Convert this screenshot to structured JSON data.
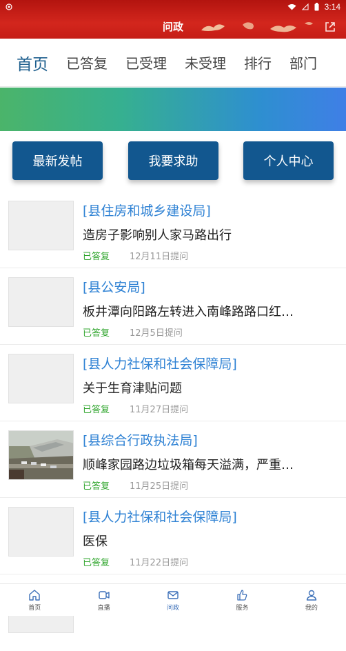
{
  "status_bar": {
    "time": "3:14"
  },
  "header": {
    "title": "问政"
  },
  "tabs": [
    {
      "label": "首页",
      "active": true
    },
    {
      "label": "已答复"
    },
    {
      "label": "已受理"
    },
    {
      "label": "未受理"
    },
    {
      "label": "排行"
    },
    {
      "label": "部门"
    }
  ],
  "quick_buttons": [
    {
      "label": "最新发帖"
    },
    {
      "label": "我要求助"
    },
    {
      "label": "个人中心"
    }
  ],
  "posts": [
    {
      "dept": "[县住房和城乡建设局]",
      "title": "造房子影响别人家马路出行",
      "status": "已答复",
      "date": "12月11日提问"
    },
    {
      "dept": "[县公安局]",
      "title": "板井潭向阳路左转进入南峰路路口红…",
      "status": "已答复",
      "date": "12月5日提问"
    },
    {
      "dept": "[县人力社保和社会保障局]",
      "title": "关于生育津贴问题",
      "status": "已答复",
      "date": "11月27日提问"
    },
    {
      "dept": "[县综合行政执法局]",
      "title": "顺峰家园路边垃圾箱每天溢满，严重…",
      "status": "已答复",
      "date": "11月25日提问"
    },
    {
      "dept": "[县人力社保和社会保障局]",
      "title": "医保",
      "status": "已答复",
      "date": "11月22日提问"
    }
  ],
  "bottom_nav": [
    {
      "label": "首页",
      "icon": "home-icon"
    },
    {
      "label": "直播",
      "icon": "video-icon"
    },
    {
      "label": "问政",
      "icon": "mail-icon",
      "active": true
    },
    {
      "label": "服务",
      "icon": "thumb-icon"
    },
    {
      "label": "我的",
      "icon": "user-icon"
    }
  ],
  "colors": {
    "header_red": "#c51d16",
    "accent_blue": "#12578f",
    "dept_blue": "#2f82d4",
    "status_green": "#2fa52c"
  }
}
